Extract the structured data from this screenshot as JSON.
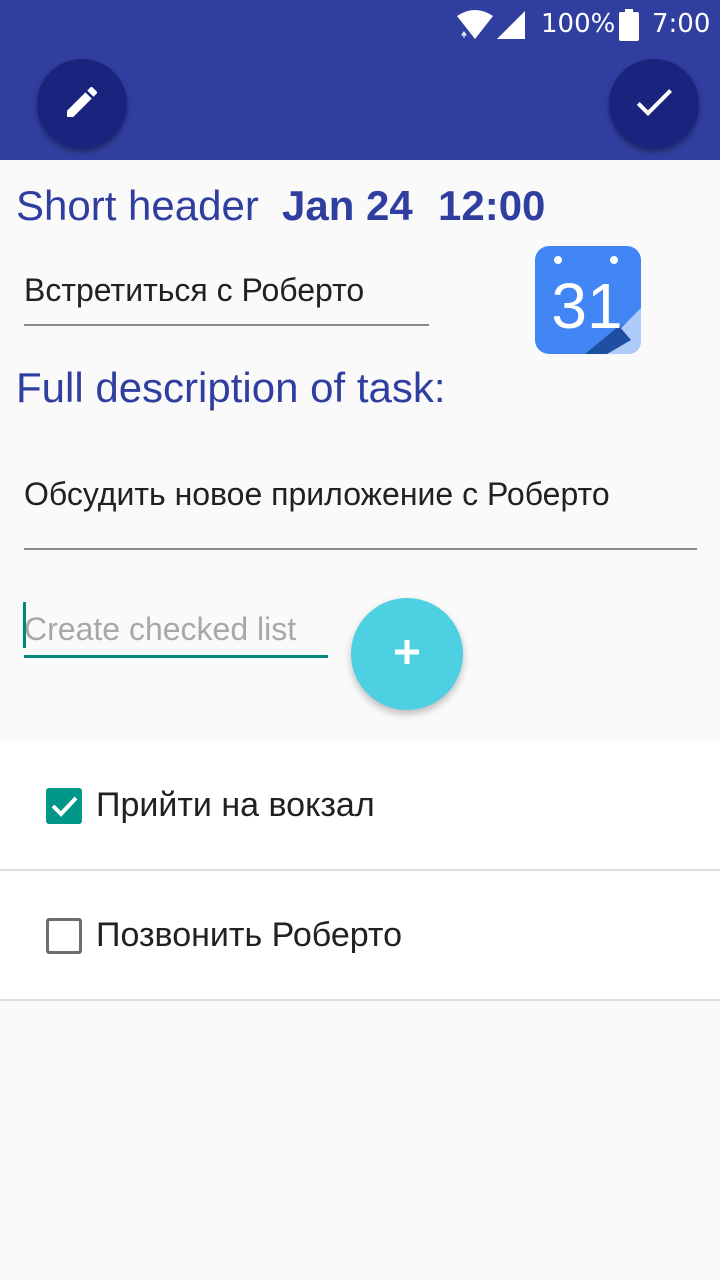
{
  "status_bar": {
    "battery": "100%",
    "time": "7:00",
    "icons": [
      "wifi-icon",
      "signal-icon",
      "battery-icon"
    ]
  },
  "toolbar": {
    "left_icon": "pencil-icon",
    "right_icon": "checkmark-icon"
  },
  "task": {
    "short_header_label": "Short header",
    "date": "Jan 24",
    "time": "12:00",
    "title_value": "Встретиться с Роберто",
    "calendar_day": "31",
    "description_label": "Full description of task:",
    "description_value": "Обсудить новое приложение с Роберто"
  },
  "checklist": {
    "placeholder": "Create checked list",
    "add_icon": "plus-icon",
    "items": [
      {
        "label": "Прийти на вокзал",
        "checked": true
      },
      {
        "label": "Позвонить Роберто",
        "checked": false
      }
    ]
  },
  "colors": {
    "primary": "#303f9f",
    "primary_dark": "#1a237e",
    "accent": "#4dd0e1",
    "checkbox": "#009688",
    "calendar_blue": "#4285f4"
  }
}
